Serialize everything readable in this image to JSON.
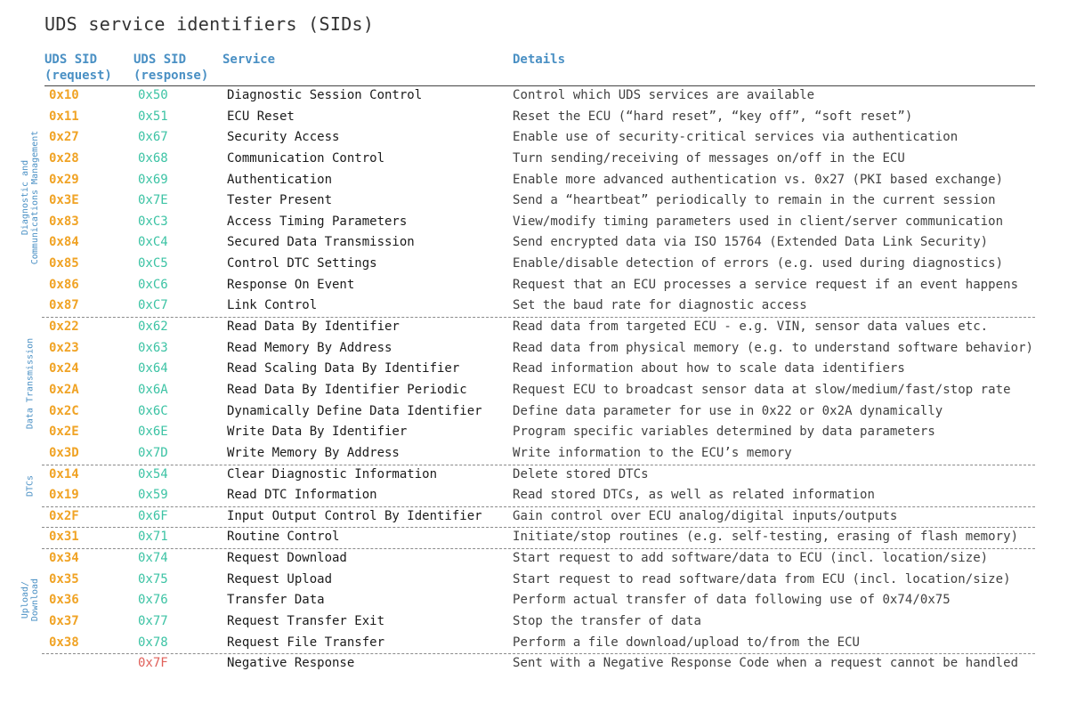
{
  "title": "UDS service identifiers (SIDs)",
  "headers": {
    "request": [
      "UDS SID",
      "(request)"
    ],
    "response": [
      "UDS SID",
      "(response)"
    ],
    "service": "Service",
    "details": "Details"
  },
  "groups": [
    {
      "lines": [
        "Diagnostic and",
        "Communications Management"
      ]
    },
    {
      "lines": [
        "Data Transmission"
      ]
    },
    {
      "lines": [
        "DTCs"
      ]
    },
    {
      "lines": [
        "Upload/",
        "Download"
      ]
    }
  ],
  "rows": [
    {
      "req": "0x10",
      "res": "0x50",
      "service": "Diagnostic Session Control",
      "details": "Control which UDS services are available"
    },
    {
      "req": "0x11",
      "res": "0x51",
      "service": "ECU Reset",
      "details": "Reset the ECU (“hard reset”, “key off”, “soft reset”)"
    },
    {
      "req": "0x27",
      "res": "0x67",
      "service": "Security Access",
      "details": "Enable use of security-critical services via authentication"
    },
    {
      "req": "0x28",
      "res": "0x68",
      "service": "Communication Control",
      "details": "Turn sending/receiving of messages on/off in the ECU"
    },
    {
      "req": "0x29",
      "res": "0x69",
      "service": "Authentication",
      "details": "Enable more advanced authentication vs. 0x27 (PKI based exchange)"
    },
    {
      "req": "0x3E",
      "res": "0x7E",
      "service": "Tester Present",
      "details": "Send a “heartbeat” periodically to remain in the current session"
    },
    {
      "req": "0x83",
      "res": "0xC3",
      "service": "Access Timing Parameters",
      "details": "View/modify timing parameters used in client/server communication"
    },
    {
      "req": "0x84",
      "res": "0xC4",
      "service": "Secured Data Transmission",
      "details": "Send encrypted data via ISO 15764 (Extended Data Link Security)"
    },
    {
      "req": "0x85",
      "res": "0xC5",
      "service": "Control DTC Settings",
      "details": "Enable/disable detection of errors (e.g. used during diagnostics)"
    },
    {
      "req": "0x86",
      "res": "0xC6",
      "service": "Response On Event",
      "details": "Request that an ECU processes a service request if an event happens"
    },
    {
      "req": "0x87",
      "res": "0xC7",
      "service": "Link Control",
      "details": "Set the baud rate for diagnostic access"
    },
    {
      "req": "0x22",
      "res": "0x62",
      "service": "Read Data By Identifier",
      "details": "Read data from targeted ECU - e.g. VIN, sensor data values etc."
    },
    {
      "req": "0x23",
      "res": "0x63",
      "service": "Read Memory By Address",
      "details": "Read data from physical memory (e.g. to understand software behavior)"
    },
    {
      "req": "0x24",
      "res": "0x64",
      "service": "Read Scaling Data By Identifier",
      "details": "Read information about how to scale data identifiers"
    },
    {
      "req": "0x2A",
      "res": "0x6A",
      "service": "Read Data By Identifier Periodic",
      "details": "Request ECU to broadcast sensor data at slow/medium/fast/stop rate"
    },
    {
      "req": "0x2C",
      "res": "0x6C",
      "service": "Dynamically Define Data Identifier",
      "details": "Define data parameter for use in 0x22 or 0x2A dynamically"
    },
    {
      "req": "0x2E",
      "res": "0x6E",
      "service": "Write Data By Identifier",
      "details": "Program specific variables determined by data parameters"
    },
    {
      "req": "0x3D",
      "res": "0x7D",
      "service": "Write Memory By Address",
      "details": "Write information to the ECU’s memory"
    },
    {
      "req": "0x14",
      "res": "0x54",
      "service": "Clear Diagnostic Information",
      "details": "Delete stored DTCs"
    },
    {
      "req": "0x19",
      "res": "0x59",
      "service": "Read DTC Information",
      "details": "Read stored DTCs, as well as related information"
    },
    {
      "req": "0x2F",
      "res": "0x6F",
      "service": "Input Output Control By Identifier",
      "details": "Gain control over ECU analog/digital inputs/outputs"
    },
    {
      "req": "0x31",
      "res": "0x71",
      "service": "Routine Control",
      "details": "Initiate/stop routines (e.g. self-testing, erasing of flash memory)"
    },
    {
      "req": "0x34",
      "res": "0x74",
      "service": "Request Download",
      "details": "Start request to add software/data to ECU (incl. location/size)"
    },
    {
      "req": "0x35",
      "res": "0x75",
      "service": "Request Upload",
      "details": "Start request to read software/data from ECU (incl. location/size)"
    },
    {
      "req": "0x36",
      "res": "0x76",
      "service": "Transfer Data",
      "details": "Perform actual transfer of data following use of 0x74/0x75"
    },
    {
      "req": "0x37",
      "res": "0x77",
      "service": "Request Transfer Exit",
      "details": "Stop the transfer of data"
    },
    {
      "req": "0x38",
      "res": "0x78",
      "service": "Request File Transfer",
      "details": "Perform a file download/upload to/from the ECU"
    },
    {
      "req": "",
      "res": "0x7F",
      "service": "Negative Response",
      "details": "Sent with a Negative Response Code when a request cannot be handled"
    }
  ],
  "colors": {
    "request": "#f0a325",
    "response": "#3cc3a4",
    "negative_response": "#e0605a",
    "header": "#4a90c4"
  }
}
